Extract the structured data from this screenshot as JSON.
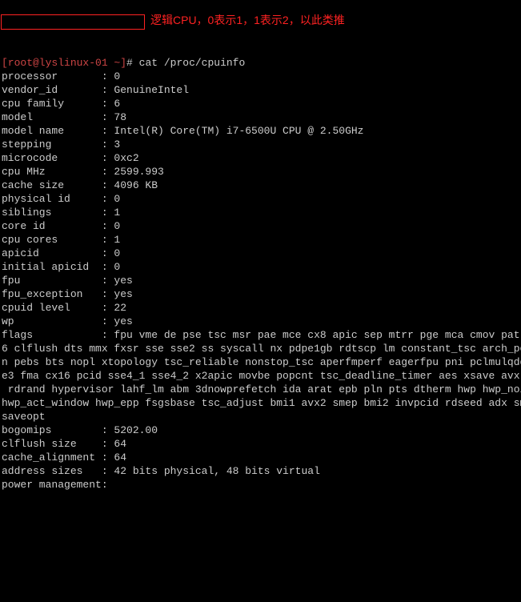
{
  "prompt": {
    "user_host": "[root@lyslinux-01 ~]",
    "hash": "#",
    "command": "cat /proc/cpuinfo"
  },
  "annotation": "逻辑CPU，0表示1，1表示2，以此类推",
  "fields": [
    {
      "k": "processor",
      "v": "0"
    },
    {
      "k": "vendor_id",
      "v": "GenuineIntel"
    },
    {
      "k": "cpu family",
      "v": "6"
    },
    {
      "k": "model",
      "v": "78"
    },
    {
      "k": "model name",
      "v": "Intel(R) Core(TM) i7-6500U CPU @ 2.50GHz"
    },
    {
      "k": "stepping",
      "v": "3"
    },
    {
      "k": "microcode",
      "v": "0xc2"
    },
    {
      "k": "cpu MHz",
      "v": "2599.993"
    },
    {
      "k": "cache size",
      "v": "4096 KB"
    },
    {
      "k": "physical id",
      "v": "0"
    },
    {
      "k": "siblings",
      "v": "1"
    },
    {
      "k": "core id",
      "v": "0"
    },
    {
      "k": "cpu cores",
      "v": "1"
    },
    {
      "k": "apicid",
      "v": "0"
    },
    {
      "k": "initial apicid",
      "v": "0"
    },
    {
      "k": "fpu",
      "v": "yes"
    },
    {
      "k": "fpu_exception",
      "v": "yes"
    },
    {
      "k": "cpuid level",
      "v": "22"
    },
    {
      "k": "wp",
      "v": "yes"
    }
  ],
  "flags_key": "flags",
  "flags_value": "fpu vme de pse tsc msr pae mce cx8 apic sep mtrr pge mca cmov pat pse36 clflush dts mmx fxsr sse sse2 ss syscall nx pdpe1gb rdtscp lm constant_tsc arch_perfmon pebs bts nopl xtopology tsc_reliable nonstop_tsc aperfmperf eagerfpu pni pclmulqdq ssse3 fma cx16 pcid sse4_1 sse4_2 x2apic movbe popcnt tsc_deadline_timer aes xsave avx f16c rdrand hypervisor lahf_lm abm 3dnowprefetch ida arat epb pln pts dtherm hwp hwp_noitfy hwp_act_window hwp_epp fsgsbase tsc_adjust bmi1 avx2 smep bmi2 invpcid rdseed adx smap xsaveopt",
  "tail": [
    {
      "k": "bogomips",
      "v": "5202.00"
    },
    {
      "k": "clflush size",
      "v": "64"
    },
    {
      "k": "cache_alignment",
      "v": "64"
    },
    {
      "k": "address sizes",
      "v": "42 bits physical, 48 bits virtual"
    },
    {
      "k": "power management",
      "v": ""
    }
  ]
}
